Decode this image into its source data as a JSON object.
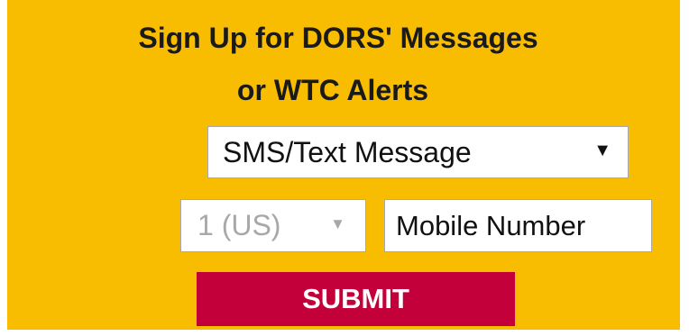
{
  "form": {
    "title_line1": "Sign Up for DORS' Messages",
    "title_line2": "or WTC Alerts",
    "contact_type": {
      "selected": "SMS/Text Message",
      "arrow_icon": "triangle-down-icon"
    },
    "country_code": {
      "selected": "1 (US)",
      "arrow_icon": "triangle-down-icon"
    },
    "mobile_number": {
      "value": "",
      "placeholder": "Mobile Number"
    },
    "submit_label": "SUBMIT"
  },
  "colors": {
    "panel_background": "#f8bd00",
    "submit_background": "#c4003b",
    "submit_text": "#ffffff",
    "disabled_text": "#a8a8a8"
  }
}
